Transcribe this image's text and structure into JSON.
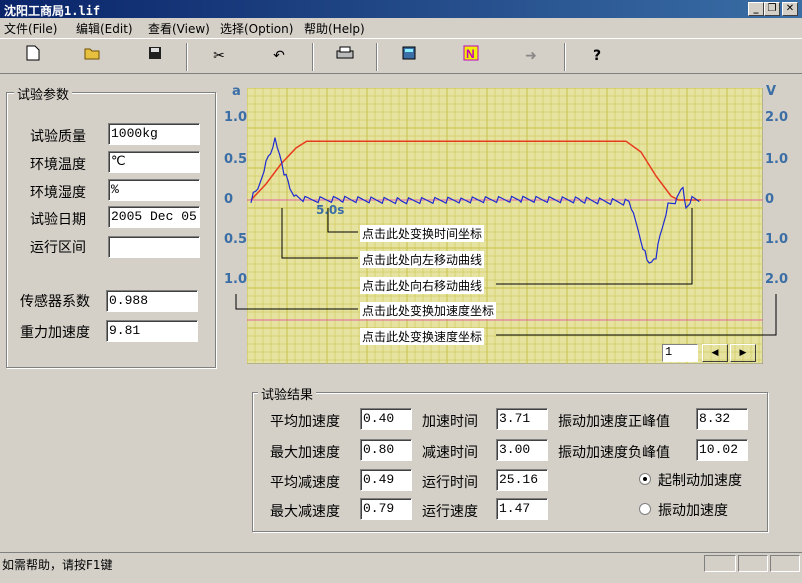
{
  "window": {
    "title": "沈阳工商局1.lif"
  },
  "menu": [
    "文件(File)",
    "编辑(Edit)",
    "查看(View)",
    "选择(Option)",
    "帮助(Help)"
  ],
  "toolbar": {
    "icons": [
      "new-file-icon",
      "open-folder-icon",
      "save-icon",
      "cut-icon",
      "undo-icon",
      "print-icon",
      "calculator-icon",
      "n-icon",
      "arrow-right-icon",
      "help-icon"
    ]
  },
  "params": {
    "title": "试验参数",
    "rows": [
      {
        "label": "试验质量",
        "value": "1000kg"
      },
      {
        "label": "环境温度",
        "value": "℃"
      },
      {
        "label": "环境湿度",
        "value": "%"
      },
      {
        "label": "试验日期",
        "value": "2005 Dec 05"
      },
      {
        "label": "运行区间",
        "value": ""
      }
    ],
    "sensor_label": "传感器系数",
    "sensor_value": "0.988",
    "gravity_label": "重力加速度",
    "gravity_value": "9.81"
  },
  "chart": {
    "left_unit": "a",
    "right_unit": "V",
    "left_ticks": [
      "1.0",
      "0.5",
      "0",
      "0.5",
      "1.0"
    ],
    "right_ticks": [
      "2.0",
      "1.0",
      "0",
      "1.0",
      "2.0"
    ],
    "time_marker": "5.0s",
    "callouts": [
      "点击此处变换时间坐标",
      "点击此处向左移动曲线",
      "点击此处向右移动曲线",
      "点击此处变换加速度坐标",
      "点击此处变换速度坐标"
    ],
    "page_value": "1",
    "colors": {
      "background": "#e6e3a0",
      "grid": "#c7c24a",
      "accel": "#1e2bd1",
      "speed": "#e83a1e",
      "zero": "#e060a0"
    }
  },
  "chart_data": {
    "type": "line",
    "xlabel": "",
    "ylabel": "a",
    "y2label": "V",
    "ylim": [
      -1.0,
      1.0
    ],
    "y2lim": [
      -2.0,
      2.0
    ],
    "series": [
      {
        "axis": "left",
        "points": [
          [
            0,
            0
          ],
          [
            0.3,
            0.12
          ],
          [
            0.6,
            0.2
          ],
          [
            1.0,
            0.45
          ],
          [
            1.3,
            0.6
          ],
          [
            1.6,
            0.78
          ],
          [
            1.9,
            0.55
          ],
          [
            2.2,
            0.35
          ],
          [
            2.6,
            0.15
          ],
          [
            3.0,
            0.05
          ],
          [
            3.71,
            0.0
          ],
          [
            6,
            0.01
          ],
          [
            10,
            -0.01
          ],
          [
            14,
            0.0
          ],
          [
            18,
            0.01
          ],
          [
            22,
            0.0
          ],
          [
            25.2,
            -0.03
          ],
          [
            25.5,
            -0.2
          ],
          [
            26.0,
            -0.5
          ],
          [
            26.4,
            -0.75
          ],
          [
            26.7,
            -0.8
          ],
          [
            27.0,
            -0.7
          ],
          [
            27.4,
            -0.35
          ],
          [
            27.8,
            -0.05
          ],
          [
            28.4,
            0.0
          ],
          [
            28.8,
            0.18
          ],
          [
            29.0,
            -0.1
          ],
          [
            29.4,
            0.02
          ],
          [
            30,
            0.0
          ]
        ]
      },
      {
        "axis": "right",
        "points": [
          [
            0,
            0
          ],
          [
            1,
            0.4
          ],
          [
            2,
            0.9
          ],
          [
            3,
            1.3
          ],
          [
            3.71,
            1.47
          ],
          [
            10,
            1.47
          ],
          [
            20,
            1.47
          ],
          [
            25,
            1.47
          ],
          [
            26,
            1.2
          ],
          [
            27,
            0.6
          ],
          [
            28,
            0.1
          ],
          [
            28.5,
            0.0
          ],
          [
            30,
            0.0
          ]
        ]
      }
    ]
  },
  "results": {
    "title": "试验结果",
    "avg_acc_label": "平均加速度",
    "avg_acc": "0.40",
    "acc_time_label": "加速时间",
    "acc_time": "3.71",
    "vib_pos_label": "振动加速度正峰值",
    "vib_pos": "8.32",
    "max_acc_label": "最大加速度",
    "max_acc": "0.80",
    "dec_time_label": "减速时间",
    "dec_time": "3.00",
    "vib_neg_label": "振动加速度负峰值",
    "vib_neg": "10.02",
    "avg_dec_label": "平均减速度",
    "avg_dec": "0.49",
    "run_time_label": "运行时间",
    "run_time": "25.16",
    "radio1": "起制动加速度",
    "max_dec_label": "最大减速度",
    "max_dec": "0.79",
    "run_speed_label": "运行速度",
    "run_speed": "1.47",
    "radio2": "振动加速度"
  },
  "status": {
    "text": "如需帮助，请按F1键"
  }
}
